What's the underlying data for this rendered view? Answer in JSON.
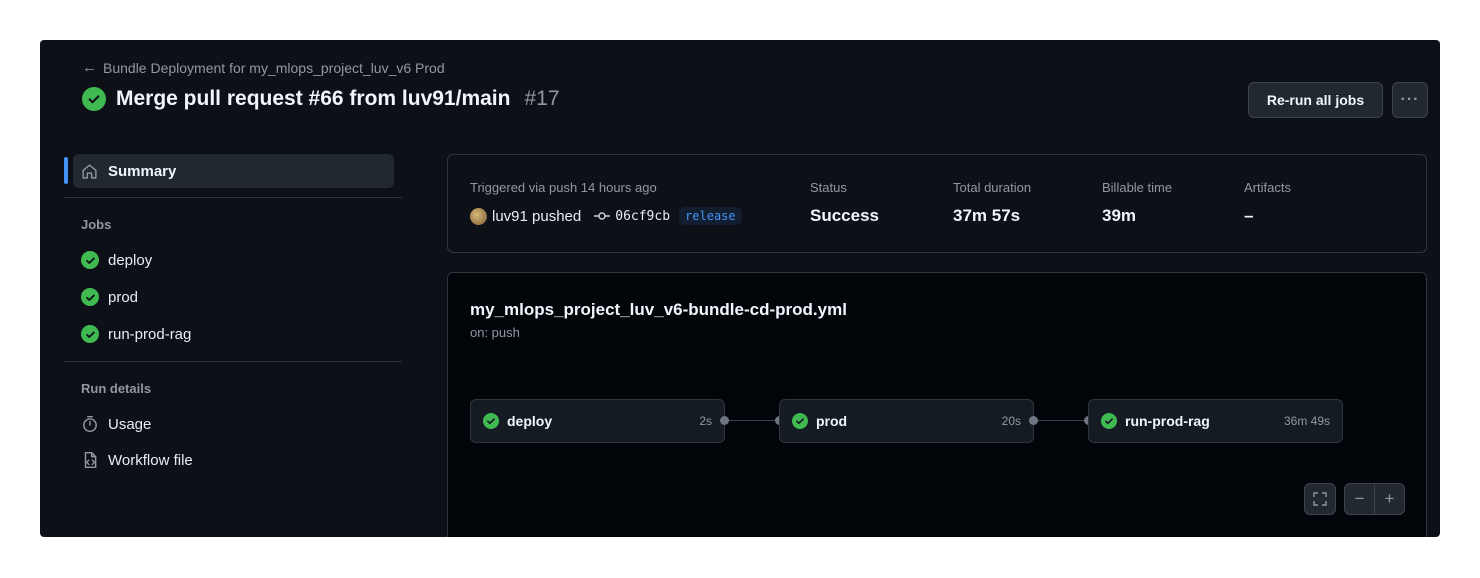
{
  "header": {
    "back_link": "Bundle Deployment for my_mlops_project_luv_v6 Prod",
    "title": "Merge pull request #66 from luv91/main",
    "run_number": "#17",
    "rerun_label": "Re-run all jobs",
    "more_label": "···"
  },
  "sidebar": {
    "summary_label": "Summary",
    "jobs_heading": "Jobs",
    "jobs": [
      {
        "label": "deploy",
        "status": "success"
      },
      {
        "label": "prod",
        "status": "success"
      },
      {
        "label": "run-prod-rag",
        "status": "success"
      }
    ],
    "run_details_heading": "Run details",
    "usage_label": "Usage",
    "workflow_file_label": "Workflow file"
  },
  "summary": {
    "trigger_label": "Triggered via push 14 hours ago",
    "actor": "luv91 pushed",
    "commit": "06cf9cb",
    "branch": "release",
    "status_label": "Status",
    "status_value": "Success",
    "duration_label": "Total duration",
    "duration_value": "37m 57s",
    "billable_label": "Billable time",
    "billable_value": "39m",
    "artifacts_label": "Artifacts",
    "artifacts_value": "–"
  },
  "workflow": {
    "file_name": "my_mlops_project_luv_v6-bundle-cd-prod.yml",
    "trigger": "on: push",
    "jobs": [
      {
        "name": "deploy",
        "duration": "2s"
      },
      {
        "name": "prod",
        "duration": "20s"
      },
      {
        "name": "run-prod-rag",
        "duration": "36m 49s"
      }
    ]
  },
  "colors": {
    "success": "#3fb950",
    "accent": "#4493f8",
    "background": "#0d1117"
  },
  "icons": {
    "back": "arrow-left-icon",
    "status": "check-circle-icon",
    "summary": "home-icon",
    "usage": "stopwatch-icon",
    "workflow_file": "file-code-icon",
    "commit": "git-commit-icon",
    "fullscreen": "fullscreen-icon",
    "zoom_out": "minus-icon",
    "zoom_in": "plus-icon"
  }
}
